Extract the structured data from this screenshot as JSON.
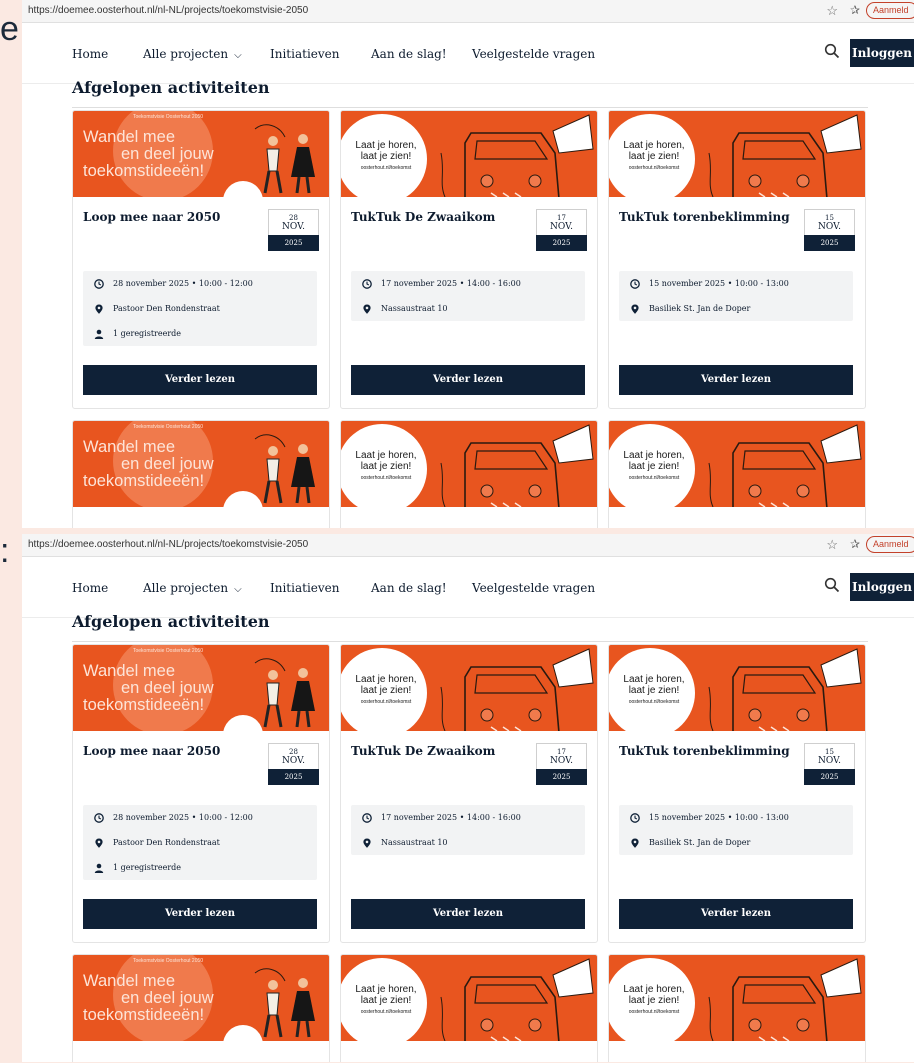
{
  "edge": {
    "top_glyph": "e",
    "mid_glyph": ":"
  },
  "browser": {
    "url": "https://doemee.oosterhout.nl/nl-NL/projects/toekomstvisie-2050",
    "account_pill": "Aanmeld"
  },
  "nav": {
    "home": "Home",
    "projects": "Alle projecten",
    "initiatives": "Initiatieven",
    "get_started": "Aan de slag!",
    "faq": "Veelgestelde vragen",
    "login": "Inloggen"
  },
  "section_title": "Afgelopen activiteiten",
  "banners": {
    "walk": {
      "small": "Toekomstvisie Oosterhout 2050",
      "line1": "Wandel mee",
      "line2": "en deel jouw",
      "line3": "toekomstideeën!"
    },
    "tuktuk": {
      "line1": "Laat je horen,",
      "line2": "laat je zien!",
      "url": "oosterhout.nl/toekomst"
    }
  },
  "cards": [
    {
      "title": "Loop mee naar 2050",
      "day": "28",
      "month": "NOV.",
      "year": "2025",
      "datetime": "28 november 2025 • 10:00 - 12:00",
      "location": "Pastoor Den Rondenstraat",
      "registered": "1 geregistreerde",
      "button": "Verder lezen"
    },
    {
      "title": "TukTuk De Zwaaikom",
      "day": "17",
      "month": "NOV.",
      "year": "2025",
      "datetime": "17 november 2025 • 14:00 - 16:00",
      "location": "Nassaustraat 10",
      "button": "Verder lezen"
    },
    {
      "title": "TukTuk torenbeklimming",
      "day": "15",
      "month": "NOV.",
      "year": "2025",
      "datetime": "15 november 2025 • 10:00 - 13:00",
      "location": "Basiliek St. Jan de Doper",
      "button": "Verder lezen"
    }
  ],
  "colors": {
    "navy": "#0f2137",
    "orange": "#e8551f",
    "page_bg": "#fbe9e2"
  },
  "icons": [
    "clock-icon",
    "pin-icon",
    "person-icon",
    "search-icon",
    "chevron-down-icon",
    "star-icon",
    "favorites-icon"
  ]
}
